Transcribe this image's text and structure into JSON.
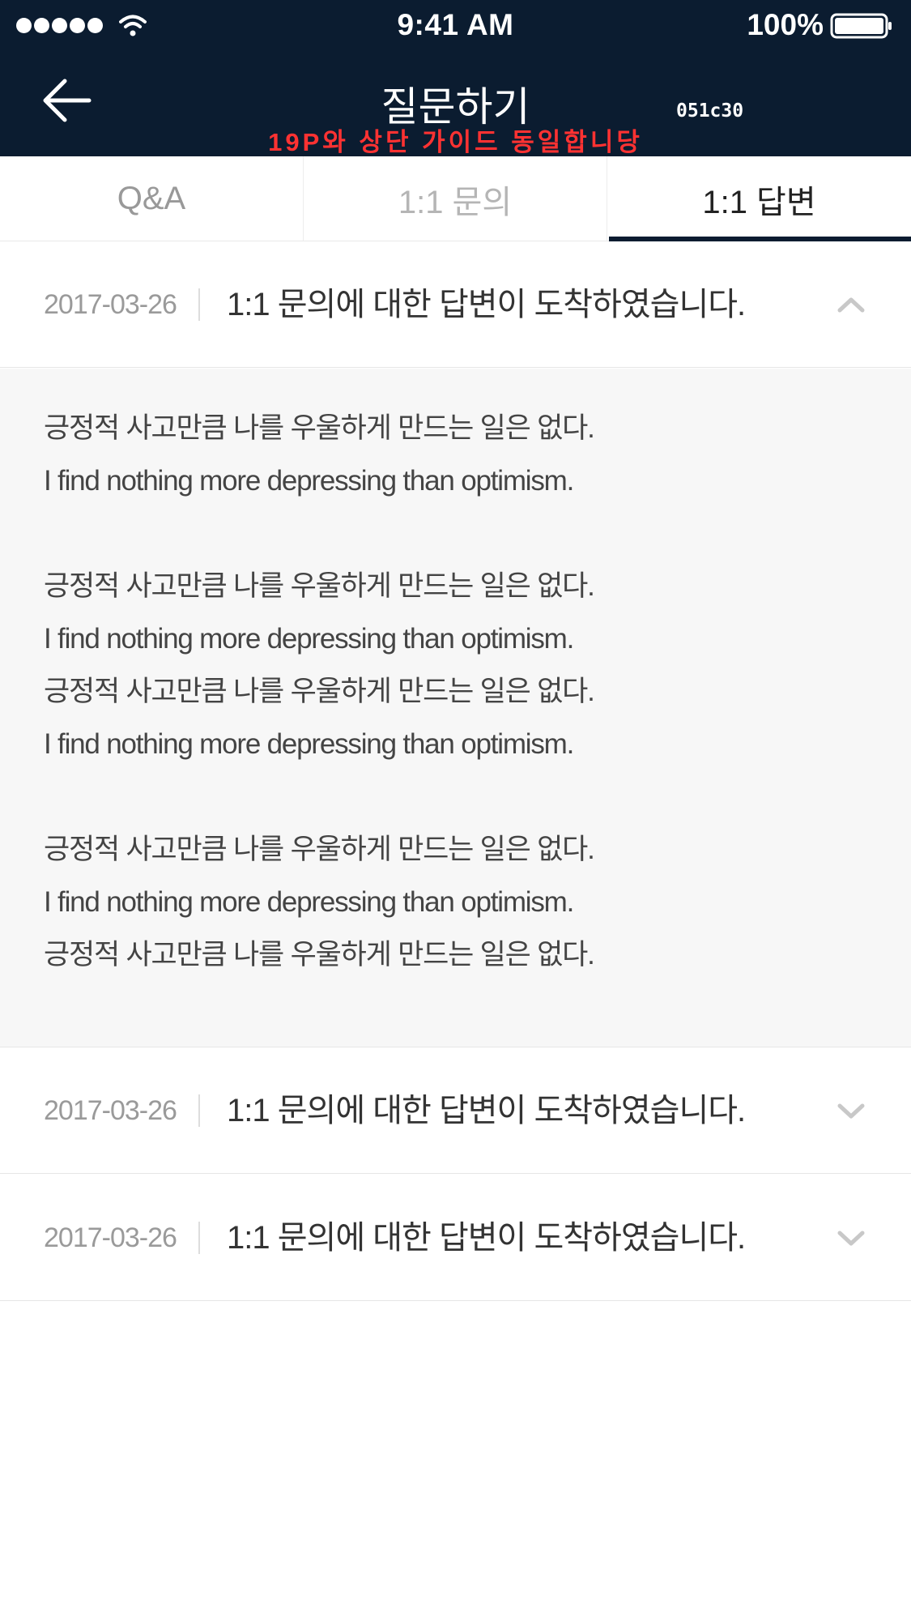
{
  "status_bar": {
    "time": "9:41 AM",
    "battery_percent": "100%",
    "signal_icon": "signal-dots-icon",
    "wifi_icon": "wifi-icon",
    "battery_icon": "battery-icon"
  },
  "nav": {
    "title": "질문하기",
    "back_icon": "arrow-left-icon",
    "code_note": "051c30",
    "guide_note": "19P와 상단 가이드 동일합니당"
  },
  "tabs": [
    {
      "label": "Q&A",
      "active": false
    },
    {
      "label": "1:1 문의",
      "active": false
    },
    {
      "label": "1:1 답변",
      "active": true
    }
  ],
  "answers": [
    {
      "date": "2017-03-26",
      "subject": "1:1 문의에 대한 답변이 도착하였습니다.",
      "expanded": true,
      "body": [
        "긍정적 사고만큼 나를 우울하게 만드는 일은 없다.",
        "I find nothing more depressing than optimism.",
        "",
        "긍정적 사고만큼 나를 우울하게 만드는 일은 없다.",
        "I find nothing more depressing than optimism.",
        "긍정적 사고만큼 나를 우울하게 만드는 일은 없다.",
        "I find nothing more depressing than optimism.",
        "",
        "긍정적 사고만큼 나를 우울하게 만드는 일은 없다.",
        "I find nothing more depressing than optimism.",
        "긍정적 사고만큼 나를 우울하게 만드는 일은 없다."
      ]
    },
    {
      "date": "2017-03-26",
      "subject": "1:1 문의에 대한 답변이 도착하였습니다.",
      "expanded": false
    },
    {
      "date": "2017-03-26",
      "subject": "1:1 문의에 대한 답변이 도착하였습니다.",
      "expanded": false
    }
  ],
  "colors": {
    "header_bg": "#0b1c30",
    "guide_note": "#ff3232",
    "active_tab_indicator": "#0b1c30",
    "answer_bg": "#f7f7f7"
  }
}
